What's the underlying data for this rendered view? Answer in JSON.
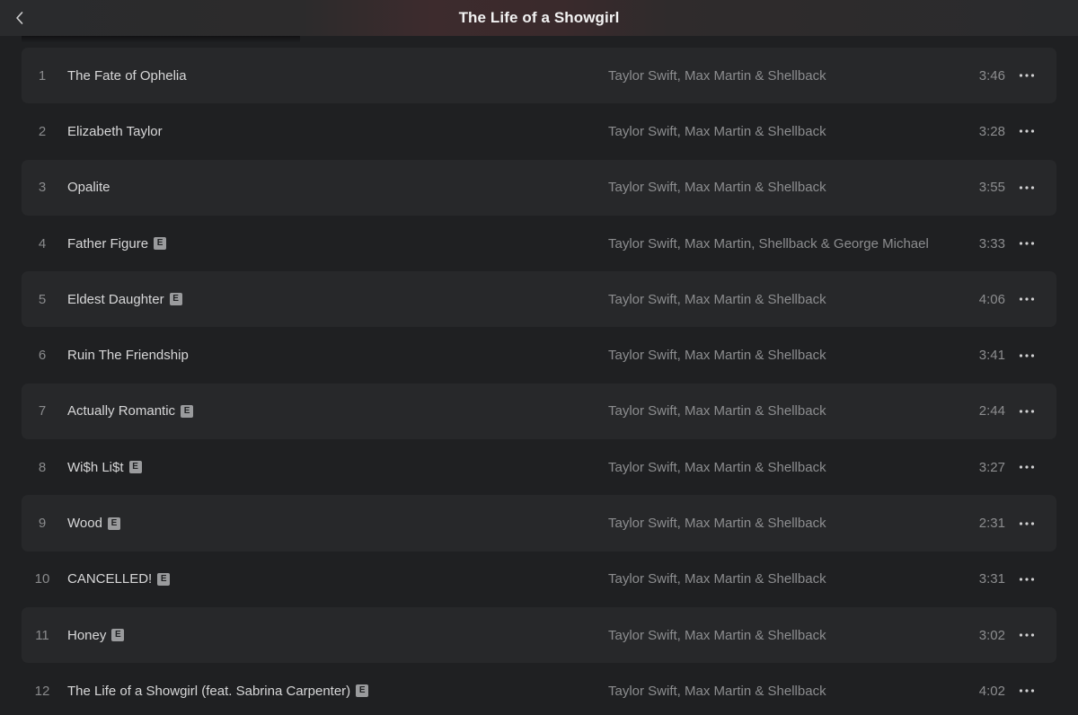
{
  "header": {
    "title": "The Life of a Showgirl",
    "back_icon": "chevron-left-icon"
  },
  "tracks": [
    {
      "number": "1",
      "title": "The Fate of Ophelia",
      "explicit": false,
      "artists": "Taylor Swift, Max Martin & Shellback",
      "duration": "3:46"
    },
    {
      "number": "2",
      "title": "Elizabeth Taylor",
      "explicit": false,
      "artists": "Taylor Swift, Max Martin & Shellback",
      "duration": "3:28"
    },
    {
      "number": "3",
      "title": "Opalite",
      "explicit": false,
      "artists": "Taylor Swift, Max Martin & Shellback",
      "duration": "3:55"
    },
    {
      "number": "4",
      "title": "Father Figure",
      "explicit": true,
      "artists": "Taylor Swift, Max Martin, Shellback & George Michael",
      "duration": "3:33"
    },
    {
      "number": "5",
      "title": "Eldest Daughter",
      "explicit": true,
      "artists": "Taylor Swift, Max Martin & Shellback",
      "duration": "4:06"
    },
    {
      "number": "6",
      "title": "Ruin The Friendship",
      "explicit": false,
      "artists": "Taylor Swift, Max Martin & Shellback",
      "duration": "3:41"
    },
    {
      "number": "7",
      "title": "Actually Romantic",
      "explicit": true,
      "artists": "Taylor Swift, Max Martin & Shellback",
      "duration": "2:44"
    },
    {
      "number": "8",
      "title": "Wi$h Li$t",
      "explicit": true,
      "artists": "Taylor Swift, Max Martin & Shellback",
      "duration": "3:27"
    },
    {
      "number": "9",
      "title": "Wood",
      "explicit": true,
      "artists": "Taylor Swift, Max Martin & Shellback",
      "duration": "2:31"
    },
    {
      "number": "10",
      "title": "CANCELLED!",
      "explicit": true,
      "artists": "Taylor Swift, Max Martin & Shellback",
      "duration": "3:31"
    },
    {
      "number": "11",
      "title": "Honey",
      "explicit": true,
      "artists": "Taylor Swift, Max Martin & Shellback",
      "duration": "3:02"
    },
    {
      "number": "12",
      "title": "The Life of a Showgirl (feat. Sabrina Carpenter)",
      "explicit": true,
      "artists": "Taylor Swift, Max Martin & Shellback",
      "duration": "4:02"
    }
  ],
  "explicit_badge_label": "E",
  "more_icon": "ellipsis-icon",
  "colors": {
    "background": "#1f2022",
    "row_alt": "#27282a",
    "title_text": "#d7d7d8",
    "secondary_text": "#8c8d8f"
  }
}
